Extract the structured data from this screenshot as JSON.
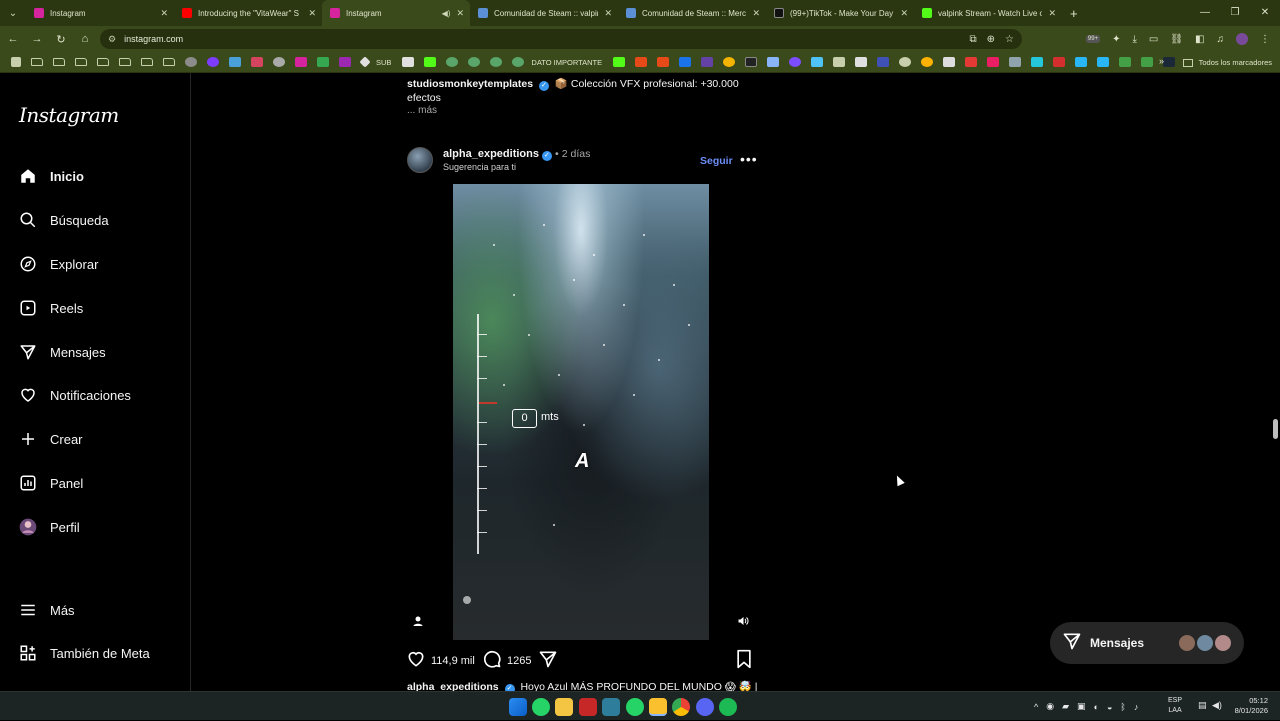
{
  "browser": {
    "tabs": [
      {
        "title": "Instagram",
        "color": "#d6249f",
        "active": false
      },
      {
        "title": "Introducing the \"VitaWear\" S",
        "color": "#ff0000",
        "active": false
      },
      {
        "title": "Instagram",
        "color": "#d6249f",
        "active": true
      },
      {
        "title": "Comunidad de Steam :: valpink's",
        "color": "#1b2838",
        "active": false
      },
      {
        "title": "Comunidad de Steam :: Mercado",
        "color": "#1b2838",
        "active": false
      },
      {
        "title": "(99+)TikTok - Make Your Day",
        "color": "#111111",
        "active": false
      },
      {
        "title": "valpink Stream - Watch Live on",
        "color": "#53fc18",
        "active": false
      }
    ],
    "url": "instagram.com",
    "badge": "99+",
    "bookmarks": {
      "sub_label": "SUB",
      "dato_label": "DATO IMPORTANTE",
      "all_label": "Todos los marcadores"
    }
  },
  "instagram": {
    "logo": "Instagram",
    "nav": [
      {
        "label": "Inicio",
        "icon": "home-icon"
      },
      {
        "label": "Búsqueda",
        "icon": "search-icon"
      },
      {
        "label": "Explorar",
        "icon": "compass-icon"
      },
      {
        "label": "Reels",
        "icon": "reels-icon"
      },
      {
        "label": "Mensajes",
        "icon": "send-icon"
      },
      {
        "label": "Notificaciones",
        "icon": "heart-icon"
      },
      {
        "label": "Crear",
        "icon": "plus-icon"
      },
      {
        "label": "Panel",
        "icon": "chart-icon"
      },
      {
        "label": "Perfil",
        "icon": "avatar-icon"
      }
    ],
    "more": "Más",
    "meta": "También de Meta",
    "prev_post": {
      "username": "studiosmonkeytemplates",
      "caption": "📦 Colección VFX profesional: +30.000 efectos",
      "more": "... más"
    },
    "post": {
      "username": "alpha_expeditions",
      "separator": "•",
      "time": "2 días",
      "subtitle": "Sugerencia para ti",
      "follow": "Seguir",
      "video": {
        "depth_value": "0",
        "depth_unit": "mts",
        "subtitle_letter": "A"
      },
      "likes": "114,9 mil",
      "comments": "1265",
      "caption": "Hoyo Azul MÁS PROFUNDO DEL MUNDO 😱 🤯 |"
    },
    "messages_pill": "Mensajes"
  },
  "taskbar": {
    "lang": "ESP",
    "layout": "LAA",
    "time": "05:12",
    "date": "8/01/2026"
  }
}
